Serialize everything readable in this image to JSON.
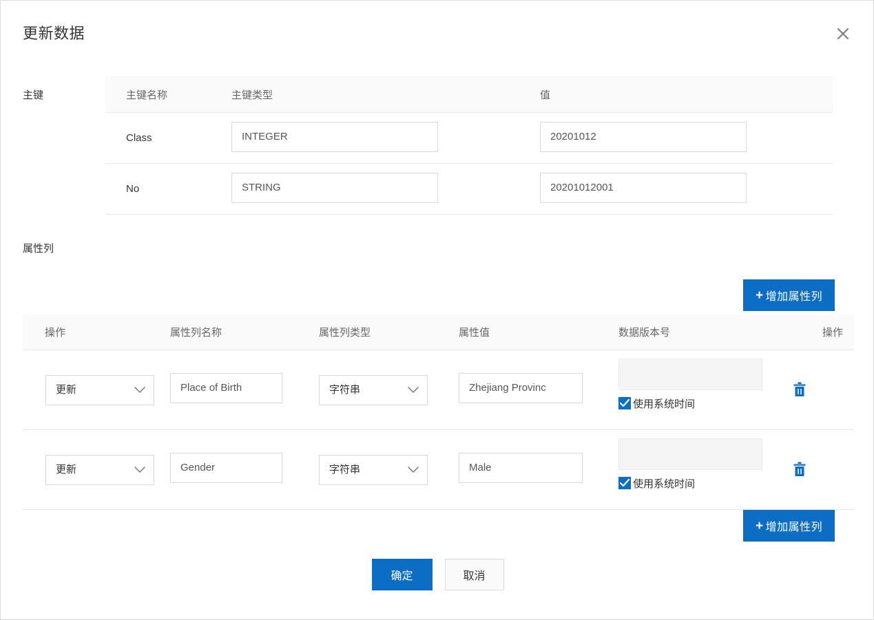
{
  "dialog": {
    "title": "更新数据",
    "close_icon": "close-icon"
  },
  "primary_key": {
    "label": "主键",
    "headers": [
      "主键名称",
      "主键类型",
      "值"
    ],
    "rows": [
      {
        "name": "Class",
        "type": "INTEGER",
        "value": "20201012"
      },
      {
        "name": "No",
        "type": "STRING",
        "value": "20201012001"
      }
    ]
  },
  "attributes": {
    "label": "属性列",
    "add_button_label": "增加属性列",
    "add_button_plus": "+",
    "headers": [
      "操作",
      "属性列名称",
      "属性列类型",
      "属性值",
      "数据版本号",
      "操作"
    ],
    "version_placeholder": "",
    "use_system_time_label": "使用系统时间",
    "delete_icon": "trash-icon",
    "rows": [
      {
        "operation": "更新",
        "name": "Place of Birth",
        "type": "字符串",
        "value": "Zhejiang Provinc",
        "version": "",
        "use_system_time": true
      },
      {
        "operation": "更新",
        "name": "Gender",
        "type": "字符串",
        "value": "Male",
        "version": "",
        "use_system_time": true
      }
    ]
  },
  "footer": {
    "confirm_label": "确定",
    "cancel_label": "取消"
  },
  "colors": {
    "accent": "#0b6ec4",
    "header_bg": "#fafafa",
    "border": "#e8e8e8",
    "input_border": "#d9d9d9",
    "disabled_bg": "#f5f5f5",
    "text": "#333333",
    "muted_text": "#666666"
  }
}
